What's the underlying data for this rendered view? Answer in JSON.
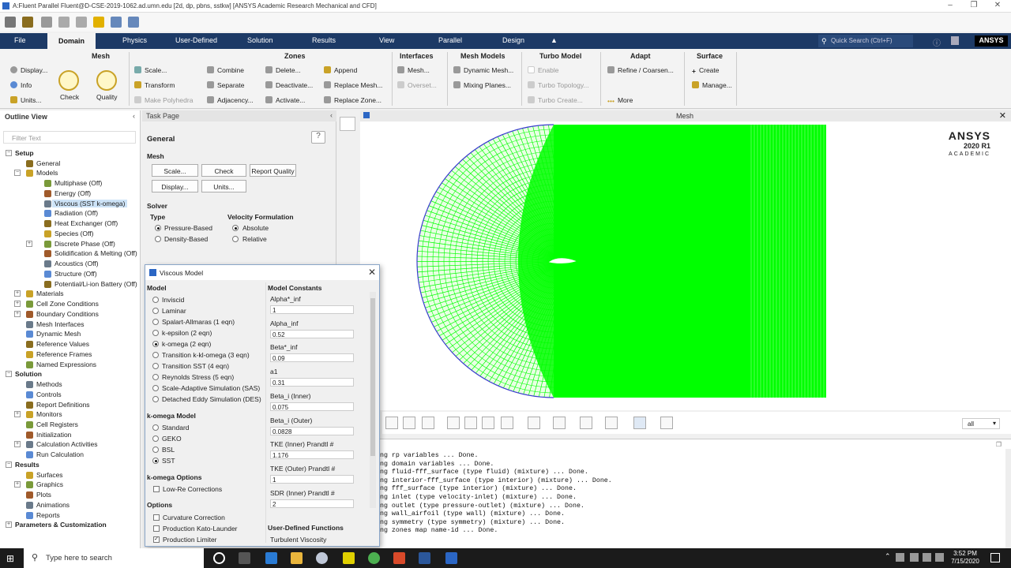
{
  "window": {
    "title": "A:Fluent Parallel Fluent@D-CSE-2019-1062.ad.umn.edu  [2d, dp, pbns, sstkw] [ANSYS Academic Research Mechanical and CFD]"
  },
  "ribbon_tabs": [
    "File",
    "Domain",
    "Physics",
    "User-Defined",
    "Solution",
    "Results",
    "View",
    "Parallel",
    "Design"
  ],
  "quick_search": "Quick Search (Ctrl+F)",
  "logo": "ANSYS",
  "ribbon": {
    "mesh": {
      "title": "Mesh",
      "display": "Display...",
      "info": "Info",
      "units": "Units...",
      "check": "Check",
      "quality": "Quality"
    },
    "zones": {
      "title": "Zones",
      "scale": "Scale...",
      "transform": "Transform",
      "make_polyhedra": "Make Polyhedra",
      "combine": "Combine",
      "separate": "Separate",
      "adjacency": "Adjacency...",
      "delete": "Delete...",
      "deactivate": "Deactivate...",
      "activate": "Activate...",
      "append": "Append",
      "replace_mesh": "Replace Mesh...",
      "replace_zone": "Replace Zone..."
    },
    "interfaces": {
      "title": "Interfaces",
      "mesh": "Mesh...",
      "overset": "Overset..."
    },
    "mesh_models": {
      "title": "Mesh Models",
      "dynamic_mesh": "Dynamic Mesh...",
      "mixing_planes": "Mixing Planes..."
    },
    "turbo": {
      "title": "Turbo Model",
      "enable": "Enable",
      "topology": "Turbo Topology...",
      "create": "Turbo Create..."
    },
    "adapt": {
      "title": "Adapt",
      "refine": "Refine / Coarsen...",
      "more": "More"
    },
    "surface": {
      "title": "Surface",
      "create": "Create",
      "manage": "Manage..."
    }
  },
  "outline": {
    "title": "Outline View",
    "filter_placeholder": "Filter Text",
    "items": [
      {
        "label": "Setup",
        "level": 0,
        "exp": "-",
        "bold": true
      },
      {
        "label": "General",
        "level": 1
      },
      {
        "label": "Models",
        "level": 1,
        "exp": "-"
      },
      {
        "label": "Multiphase (Off)",
        "level": 2
      },
      {
        "label": "Energy (Off)",
        "level": 2
      },
      {
        "label": "Viscous (SST k-omega)",
        "level": 2,
        "selected": true
      },
      {
        "label": "Radiation (Off)",
        "level": 2
      },
      {
        "label": "Heat Exchanger (Off)",
        "level": 2
      },
      {
        "label": "Species (Off)",
        "level": 2
      },
      {
        "label": "Discrete Phase (Off)",
        "level": 2,
        "exp": "+"
      },
      {
        "label": "Solidification & Melting (Off)",
        "level": 2
      },
      {
        "label": "Acoustics (Off)",
        "level": 2
      },
      {
        "label": "Structure (Off)",
        "level": 2
      },
      {
        "label": "Potential/Li-ion Battery (Off)",
        "level": 2
      },
      {
        "label": "Materials",
        "level": 1,
        "exp": "+"
      },
      {
        "label": "Cell Zone Conditions",
        "level": 1,
        "exp": "+"
      },
      {
        "label": "Boundary Conditions",
        "level": 1,
        "exp": "+"
      },
      {
        "label": "Mesh Interfaces",
        "level": 1
      },
      {
        "label": "Dynamic Mesh",
        "level": 1
      },
      {
        "label": "Reference Values",
        "level": 1
      },
      {
        "label": "Reference Frames",
        "level": 1
      },
      {
        "label": "Named Expressions",
        "level": 1
      },
      {
        "label": "Solution",
        "level": 0,
        "exp": "-",
        "bold": true
      },
      {
        "label": "Methods",
        "level": 1
      },
      {
        "label": "Controls",
        "level": 1
      },
      {
        "label": "Report Definitions",
        "level": 1
      },
      {
        "label": "Monitors",
        "level": 1,
        "exp": "+"
      },
      {
        "label": "Cell Registers",
        "level": 1
      },
      {
        "label": "Initialization",
        "level": 1
      },
      {
        "label": "Calculation Activities",
        "level": 1,
        "exp": "+"
      },
      {
        "label": "Run Calculation",
        "level": 1
      },
      {
        "label": "Results",
        "level": 0,
        "exp": "-",
        "bold": true
      },
      {
        "label": "Surfaces",
        "level": 1
      },
      {
        "label": "Graphics",
        "level": 1,
        "exp": "+"
      },
      {
        "label": "Plots",
        "level": 1
      },
      {
        "label": "Animations",
        "level": 1
      },
      {
        "label": "Reports",
        "level": 1
      },
      {
        "label": "Parameters & Customization",
        "level": 0,
        "exp": "+",
        "bold": true
      }
    ]
  },
  "task_page": {
    "header": "Task Page",
    "section": "General",
    "mesh_label": "Mesh",
    "buttons": {
      "scale": "Scale...",
      "check": "Check",
      "report_quality": "Report Quality",
      "display": "Display...",
      "units": "Units..."
    },
    "solver_label": "Solver",
    "type_label": "Type",
    "type_options": [
      "Pressure-Based",
      "Density-Based"
    ],
    "velocity_label": "Velocity Formulation",
    "velocity_options": [
      "Absolute",
      "Relative"
    ]
  },
  "viscous_dialog": {
    "title": "Viscous Model",
    "model_label": "Model",
    "models": [
      "Inviscid",
      "Laminar",
      "Spalart-Allmaras (1 eqn)",
      "k-epsilon (2 eqn)",
      "k-omega (2 eqn)",
      "Transition k-kl-omega (3 eqn)",
      "Transition SST (4 eqn)",
      "Reynolds Stress (5 eqn)",
      "Scale-Adaptive Simulation (SAS)",
      "Detached Eddy Simulation (DES)"
    ],
    "selected_model": "k-omega (2 eqn)",
    "komega_model_label": "k-omega Model",
    "komega_models": [
      "Standard",
      "GEKO",
      "BSL",
      "SST"
    ],
    "komega_selected": "SST",
    "komega_options_label": "k-omega Options",
    "komega_options": [
      "Low-Re Corrections"
    ],
    "options_label": "Options",
    "options": [
      {
        "label": "Curvature Correction",
        "checked": false
      },
      {
        "label": "Production Kato-Launder",
        "checked": false
      },
      {
        "label": "Production Limiter",
        "checked": true
      }
    ],
    "constants_label": "Model Constants",
    "constants": [
      {
        "name": "Alpha*_inf",
        "value": "1"
      },
      {
        "name": "Alpha_inf",
        "value": "0.52"
      },
      {
        "name": "Beta*_inf",
        "value": "0.09"
      },
      {
        "name": "a1",
        "value": "0.31"
      },
      {
        "name": "Beta_i (Inner)",
        "value": "0.075"
      },
      {
        "name": "Beta_i (Outer)",
        "value": "0.0828"
      },
      {
        "name": "TKE (Inner) Prandtl #",
        "value": "1.176"
      },
      {
        "name": "TKE (Outer) Prandtl #",
        "value": "1"
      },
      {
        "name": "SDR (Inner) Prandtl #",
        "value": "2"
      }
    ],
    "udf_label": "User-Defined Functions",
    "udf_field": "Turbulent Viscosity"
  },
  "graphics": {
    "title": "Mesh",
    "brand": "ANSYS",
    "version": "2020 R1",
    "edition": "ACADEMIC",
    "view_select": "all",
    "mesh_color": "#00ff00",
    "boundary_color": "#3a3acf"
  },
  "console": [
    "ng rp variables ... Done.",
    "ng domain variables ... Done.",
    "ng fluid-fff_surface (type fluid) (mixture) ... Done.",
    "ng interior-fff_surface (type interior) (mixture) ... Done.",
    "ng fff_surface (type interior) (mixture) ... Done.",
    "ng inlet (type velocity-inlet) (mixture) ... Done.",
    "ng outlet (type pressure-outlet) (mixture) ... Done.",
    "ng wall_airfoil (type wall) (mixture) ... Done.",
    "ng symmetry (type symmetry) (mixture) ... Done.",
    "ng zones map name-id ... Done."
  ],
  "taskbar": {
    "search_placeholder": "Type here to search",
    "time": "3:52 PM",
    "date": "7/15/2020"
  }
}
